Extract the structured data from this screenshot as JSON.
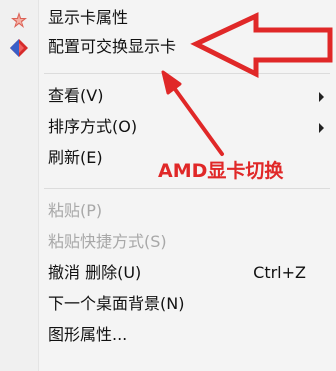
{
  "menu": {
    "items": [
      {
        "label": "显示卡属性",
        "icon": "amd-star-icon"
      },
      {
        "label": "配置可交换显示卡",
        "icon": "amd-diamond-icon"
      },
      {
        "label": "查看(V)",
        "submenu": true
      },
      {
        "label": "排序方式(O)",
        "submenu": true
      },
      {
        "label": "刷新(E)"
      },
      {
        "label": "粘贴(P)",
        "disabled": true
      },
      {
        "label": "粘贴快捷方式(S)",
        "disabled": true
      },
      {
        "label": "撤消 删除(U)",
        "shortcut": "Ctrl+Z"
      },
      {
        "label": "下一个桌面背景(N)"
      },
      {
        "label": "图形属性..."
      }
    ]
  },
  "annotation": {
    "text": "AMD显卡切换",
    "color": "#e02828"
  },
  "colors": {
    "annotation_red": "#e02828",
    "disabled_text": "#a8a8a8",
    "menu_bg": "#f4f4f4"
  }
}
